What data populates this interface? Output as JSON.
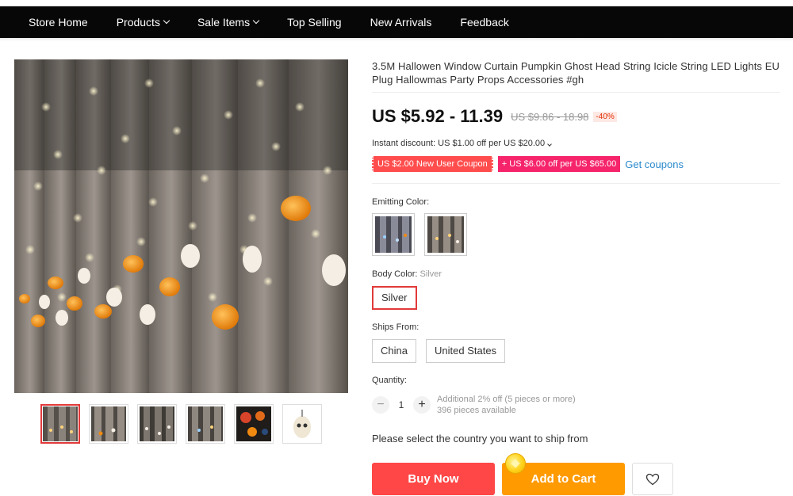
{
  "nav": {
    "items": [
      {
        "label": "Store Home",
        "dropdown": false
      },
      {
        "label": "Products",
        "dropdown": true
      },
      {
        "label": "Sale Items",
        "dropdown": true
      },
      {
        "label": "Top Selling",
        "dropdown": false
      },
      {
        "label": "New Arrivals",
        "dropdown": false
      },
      {
        "label": "Feedback",
        "dropdown": false
      }
    ]
  },
  "product": {
    "title": "3.5M Hallowen Window Curtain Pumpkin Ghost Head String Icicle String LED Lights EU Plug Hallowmas Party Props Accessories #gh",
    "price": "US $5.92 - 11.39",
    "original_price": "US $9.86 - 18.98",
    "discount": "-40%",
    "instant_discount": "Instant discount: US $1.00 off per US $20.00"
  },
  "coupons": {
    "new_user": "US $2.00 New User Coupon",
    "store": "+ US $6.00 off per US $65.00",
    "get_link": "Get coupons"
  },
  "skus": {
    "emitting_color_label": "Emitting Color:",
    "body_color_label": "Body Color:",
    "body_color_value": "Silver",
    "body_color_option": "Silver",
    "ships_from_label": "Ships From:",
    "ships_from_options": [
      "China",
      "United States"
    ]
  },
  "quantity": {
    "label": "Quantity:",
    "value": "1",
    "minus": "−",
    "plus": "+",
    "note_discount": "Additional 2% off (5 pieces or more)",
    "note_available": "396 pieces available"
  },
  "shipping_message": "Please select the country you want to ship from",
  "actions": {
    "buy_now": "Buy Now",
    "add_to_cart": "Add to Cart",
    "wishlist_icon": "heart-icon"
  },
  "colors": {
    "nav_bg": "#070707",
    "price_red": "#ff4747",
    "cart_orange": "#ff9a00",
    "link_blue": "#2a8acb"
  }
}
